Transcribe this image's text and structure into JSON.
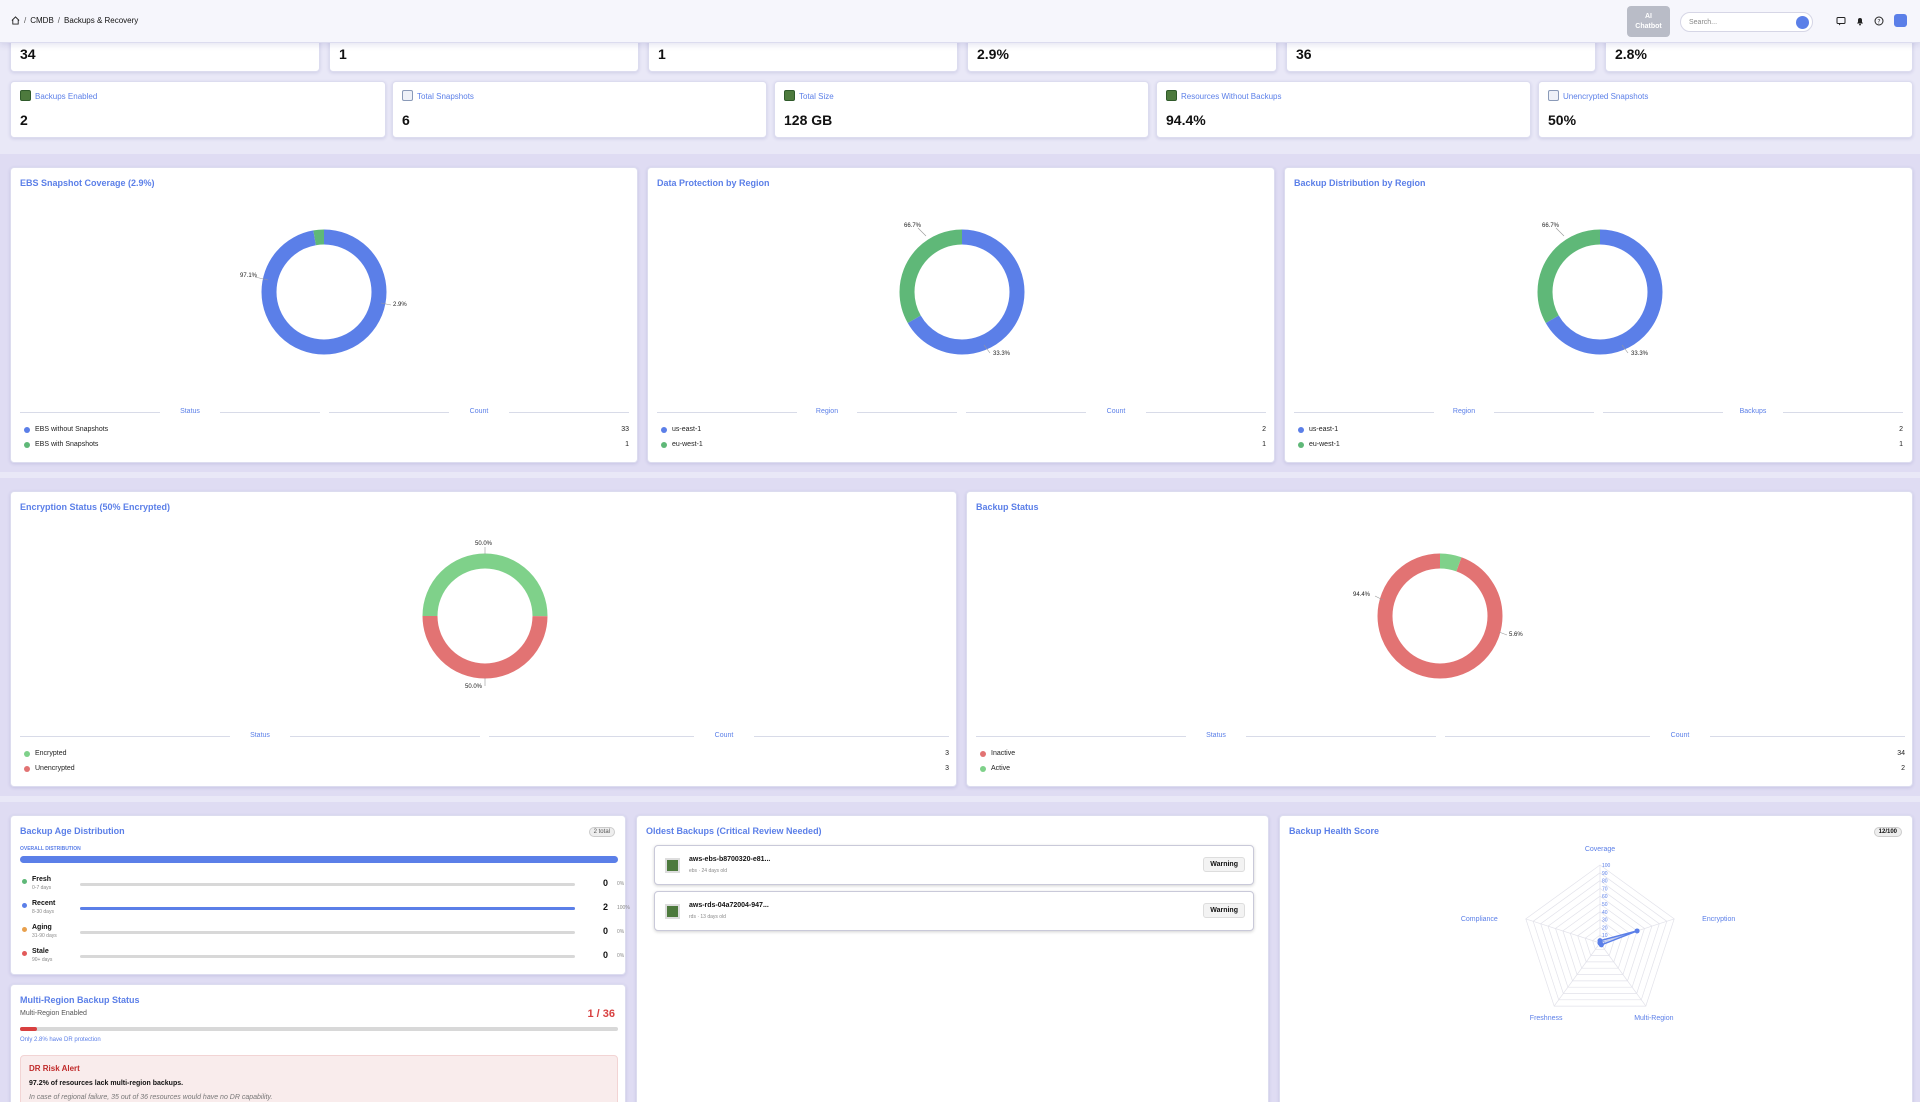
{
  "topbar": {
    "breadcrumb": [
      "CMDB",
      "Backups & Recovery"
    ],
    "chatbot_label_1": "AI",
    "chatbot_label_2": "Chatbot",
    "search_placeholder": "Search..."
  },
  "kpi_row1": [
    "34",
    "1",
    "1",
    "2.9%",
    "36",
    "2.8%"
  ],
  "kpi_row2": [
    {
      "label": "Backups Enabled",
      "value": "2",
      "icon": "chip-icon"
    },
    {
      "label": "Total Snapshots",
      "value": "6",
      "icon": "calendar-icon"
    },
    {
      "label": "Total Size",
      "value": "128 GB",
      "icon": "chip-icon"
    },
    {
      "label": "Resources Without Backups",
      "value": "94.4%",
      "icon": "chip-icon"
    },
    {
      "label": "Unencrypted Snapshots",
      "value": "50%",
      "icon": "calendar-icon"
    }
  ],
  "charts": {
    "ebs": {
      "title": "EBS Snapshot Coverage (2.9%)",
      "col1": "Status",
      "col2": "Count",
      "rows": [
        {
          "label": "EBS without Snapshots",
          "count": "33",
          "color": "#5b7fe8"
        },
        {
          "label": "EBS with Snapshots",
          "count": "1",
          "color": "#5fb878"
        }
      ],
      "pct_labels": [
        "97.1%",
        "2.9%"
      ]
    },
    "region": {
      "title": "Data Protection by Region",
      "col1": "Region",
      "col2": "Count",
      "rows": [
        {
          "label": "us-east-1",
          "count": "2",
          "color": "#5b7fe8"
        },
        {
          "label": "eu-west-1",
          "count": "1",
          "color": "#5fb878"
        }
      ],
      "pct_labels": [
        "66.7%",
        "33.3%"
      ]
    },
    "distribution": {
      "title": "Backup Distribution by Region",
      "col1": "Region",
      "col2": "Backups",
      "rows": [
        {
          "label": "us-east-1",
          "count": "2",
          "color": "#5b7fe8"
        },
        {
          "label": "eu-west-1",
          "count": "1",
          "color": "#5fb878"
        }
      ],
      "pct_labels": [
        "66.7%",
        "33.3%"
      ]
    },
    "encryption": {
      "title": "Encryption Status (50% Encrypted)",
      "col1": "Status",
      "col2": "Count",
      "rows": [
        {
          "label": "Encrypted",
          "count": "3",
          "color": "#7fd18a"
        },
        {
          "label": "Unencrypted",
          "count": "3",
          "color": "#e27373"
        }
      ],
      "pct_labels": [
        "50.0%",
        "50.0%"
      ]
    },
    "backup_status": {
      "title": "Backup Status",
      "col1": "Status",
      "col2": "Count",
      "rows": [
        {
          "label": "Inactive",
          "count": "34",
          "color": "#e27373"
        },
        {
          "label": "Active",
          "count": "2",
          "color": "#7fd18a"
        }
      ],
      "pct_labels": [
        "94.4%",
        "5.6%"
      ]
    }
  },
  "chart_data": [
    {
      "type": "pie",
      "title": "EBS Snapshot Coverage (2.9%)",
      "categories": [
        "EBS without Snapshots",
        "EBS with Snapshots"
      ],
      "values": [
        33,
        1
      ]
    },
    {
      "type": "pie",
      "title": "Data Protection by Region",
      "categories": [
        "us-east-1",
        "eu-west-1"
      ],
      "values": [
        2,
        1
      ]
    },
    {
      "type": "pie",
      "title": "Backup Distribution by Region",
      "categories": [
        "us-east-1",
        "eu-west-1"
      ],
      "values": [
        2,
        1
      ]
    },
    {
      "type": "pie",
      "title": "Encryption Status (50% Encrypted)",
      "categories": [
        "Encrypted",
        "Unencrypted"
      ],
      "values": [
        3,
        3
      ]
    },
    {
      "type": "pie",
      "title": "Backup Status",
      "categories": [
        "Inactive",
        "Active"
      ],
      "values": [
        34,
        2
      ]
    },
    {
      "type": "radar",
      "title": "Backup Health Score",
      "categories": [
        "Coverage",
        "Encryption",
        "Multi-Region",
        "Freshness",
        "Compliance"
      ],
      "values": [
        3,
        50,
        3,
        0,
        0
      ],
      "ylim": [
        0,
        100
      ],
      "ticks": [
        "100",
        "90",
        "80",
        "70",
        "60",
        "50",
        "40",
        "30",
        "20",
        "10",
        "0"
      ]
    }
  ],
  "age": {
    "title": "Backup Age Distribution",
    "badge": "2 total",
    "overall_label": "OVERALL DISTRIBUTION",
    "rows": [
      {
        "name": "Fresh",
        "sub": "0-7 days",
        "count": "0",
        "pct": "0%",
        "fill": 0,
        "color": "#5fb878"
      },
      {
        "name": "Recent",
        "sub": "8-30 days",
        "count": "2",
        "pct": "100%",
        "fill": 1,
        "color": "#5b7fe8"
      },
      {
        "name": "Aging",
        "sub": "31-90 days",
        "count": "0",
        "pct": "0%",
        "fill": 0,
        "color": "#e8a04d"
      },
      {
        "name": "Stale",
        "sub": "90+ days",
        "count": "0",
        "pct": "0%",
        "fill": 0,
        "color": "#e25a5a"
      }
    ]
  },
  "oldest": {
    "title": "Oldest Backups (Critical Review Needed)",
    "items": [
      {
        "name": "aws-ebs-b8700320-e81...",
        "sub": "ebs · 24 days old",
        "status": "Warning"
      },
      {
        "name": "aws-rds-04a72004-947...",
        "sub": "rds · 13 days old",
        "status": "Warning"
      }
    ]
  },
  "health": {
    "title": "Backup Health Score",
    "badge": "12/100"
  },
  "multiregion": {
    "title": "Multi-Region Backup Status",
    "sub": "Multi-Region Enabled",
    "count": "1 / 36",
    "fill": 0.028,
    "note": "Only 2.8% have DR protection",
    "alert_title": "DR Risk Alert",
    "alert_body": "97.2% of resources lack multi-region backups.",
    "alert_detail": "In case of regional failure, 35 out of 36 resources would have no DR capability."
  }
}
